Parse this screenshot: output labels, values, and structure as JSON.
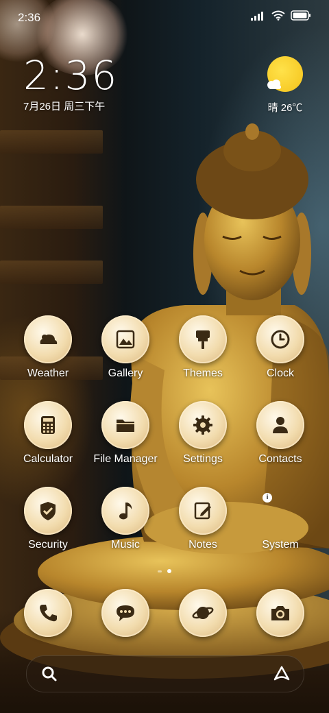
{
  "status_bar": {
    "time": "2:36",
    "icons": [
      "signal-icon",
      "wifi-icon",
      "battery-icon"
    ]
  },
  "clock_widget": {
    "time": "2:36",
    "date": "7月26日 周三下午"
  },
  "weather_widget": {
    "condition_icon": "sun-cloud-icon",
    "text": "晴 26℃"
  },
  "apps": [
    {
      "label": "Weather",
      "icon": "weather-icon"
    },
    {
      "label": "Gallery",
      "icon": "gallery-icon"
    },
    {
      "label": "Themes",
      "icon": "themes-brush-icon"
    },
    {
      "label": "Clock",
      "icon": "clock-icon"
    },
    {
      "label": "Calculator",
      "icon": "calculator-icon"
    },
    {
      "label": "File Manager",
      "icon": "folder-icon"
    },
    {
      "label": "Settings",
      "icon": "gear-icon"
    },
    {
      "label": "Contacts",
      "icon": "contact-icon"
    },
    {
      "label": "Security",
      "icon": "shield-check-icon"
    },
    {
      "label": "Music",
      "icon": "music-note-icon"
    },
    {
      "label": "Notes",
      "icon": "note-edit-icon"
    },
    {
      "label": "System",
      "icon": "folder-icon"
    }
  ],
  "dock": [
    {
      "icon": "phone-icon"
    },
    {
      "icon": "messages-icon"
    },
    {
      "icon": "browser-planet-icon"
    },
    {
      "icon": "camera-icon"
    }
  ],
  "page_indicator": {
    "pages": 2,
    "current": 2
  },
  "search_bar": {
    "left_icon": "search-icon",
    "right_icon": "assistant-icon"
  },
  "theme": {
    "icon_fg": "#3a2a14",
    "icon_bg": "#f2dcae",
    "sun_color": "#f4c21a"
  }
}
